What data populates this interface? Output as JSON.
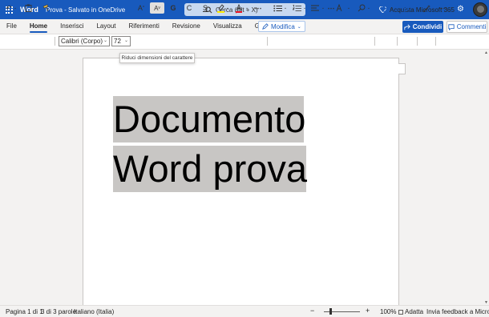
{
  "titlebar": {
    "app_name": "Word",
    "doc_title": "Prova  -  Salvato in OneDrive",
    "search_placeholder": "Cerca (Alt + X)",
    "buy_label": "Acquista Microsoft 365"
  },
  "tabs": [
    {
      "label": "File"
    },
    {
      "label": "Home"
    },
    {
      "label": "Inserisci"
    },
    {
      "label": "Layout"
    },
    {
      "label": "Riferimenti"
    },
    {
      "label": "Revisione"
    },
    {
      "label": "Visualizza"
    },
    {
      "label": "Guida"
    }
  ],
  "mode_label": "Modifica",
  "share_label": "Condividi",
  "comments_label": "Commenti",
  "ribbon": {
    "font_name": "Calibri (Corpo)",
    "font_size": "72",
    "bold_label": "G",
    "italic_label": "C",
    "underline_label": "S",
    "grow_font": "A",
    "shrink_font": "A"
  },
  "tooltip": "Riduci dimensioni del carattere",
  "document": {
    "line1": "Documento",
    "line2": "Word prova"
  },
  "status": {
    "page": "Pagina 1 di 1",
    "words": "3 di 3 parole",
    "language": "Italiano (Italia)",
    "zoom": "100%",
    "fit": "Adatta",
    "feedback": "Invia feedback a Microsoft"
  },
  "colors": {
    "brand": "#185abd",
    "highlight": "#fdeb00",
    "font_color": "#e81123",
    "selection": "#c8c6c4"
  }
}
